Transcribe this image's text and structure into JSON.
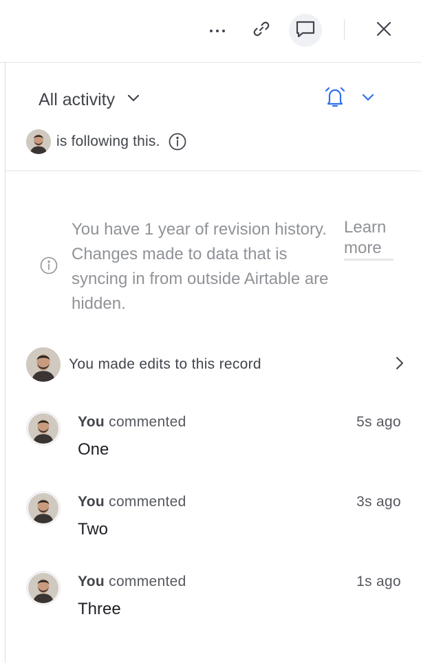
{
  "toolbar": {
    "icons": [
      "more-icon",
      "link-icon",
      "comment-icon",
      "close-icon"
    ]
  },
  "activity": {
    "filter_label": "All activity",
    "notification_icon": "bell-icon",
    "accent": "#2d6ff0"
  },
  "following": {
    "text": "is following this."
  },
  "notice": {
    "text": "You have 1 year of revision history. Changes made to data that is syncing in from outside Airtable are hidden.",
    "learn_more": "Learn more"
  },
  "edits": {
    "text": "You made edits to this record"
  },
  "comments": [
    {
      "author": "You",
      "action": "commented",
      "time": "5s ago",
      "body": "One"
    },
    {
      "author": "You",
      "action": "commented",
      "time": "3s ago",
      "body": "Two"
    },
    {
      "author": "You",
      "action": "commented",
      "time": "1s ago",
      "body": "Three"
    }
  ]
}
